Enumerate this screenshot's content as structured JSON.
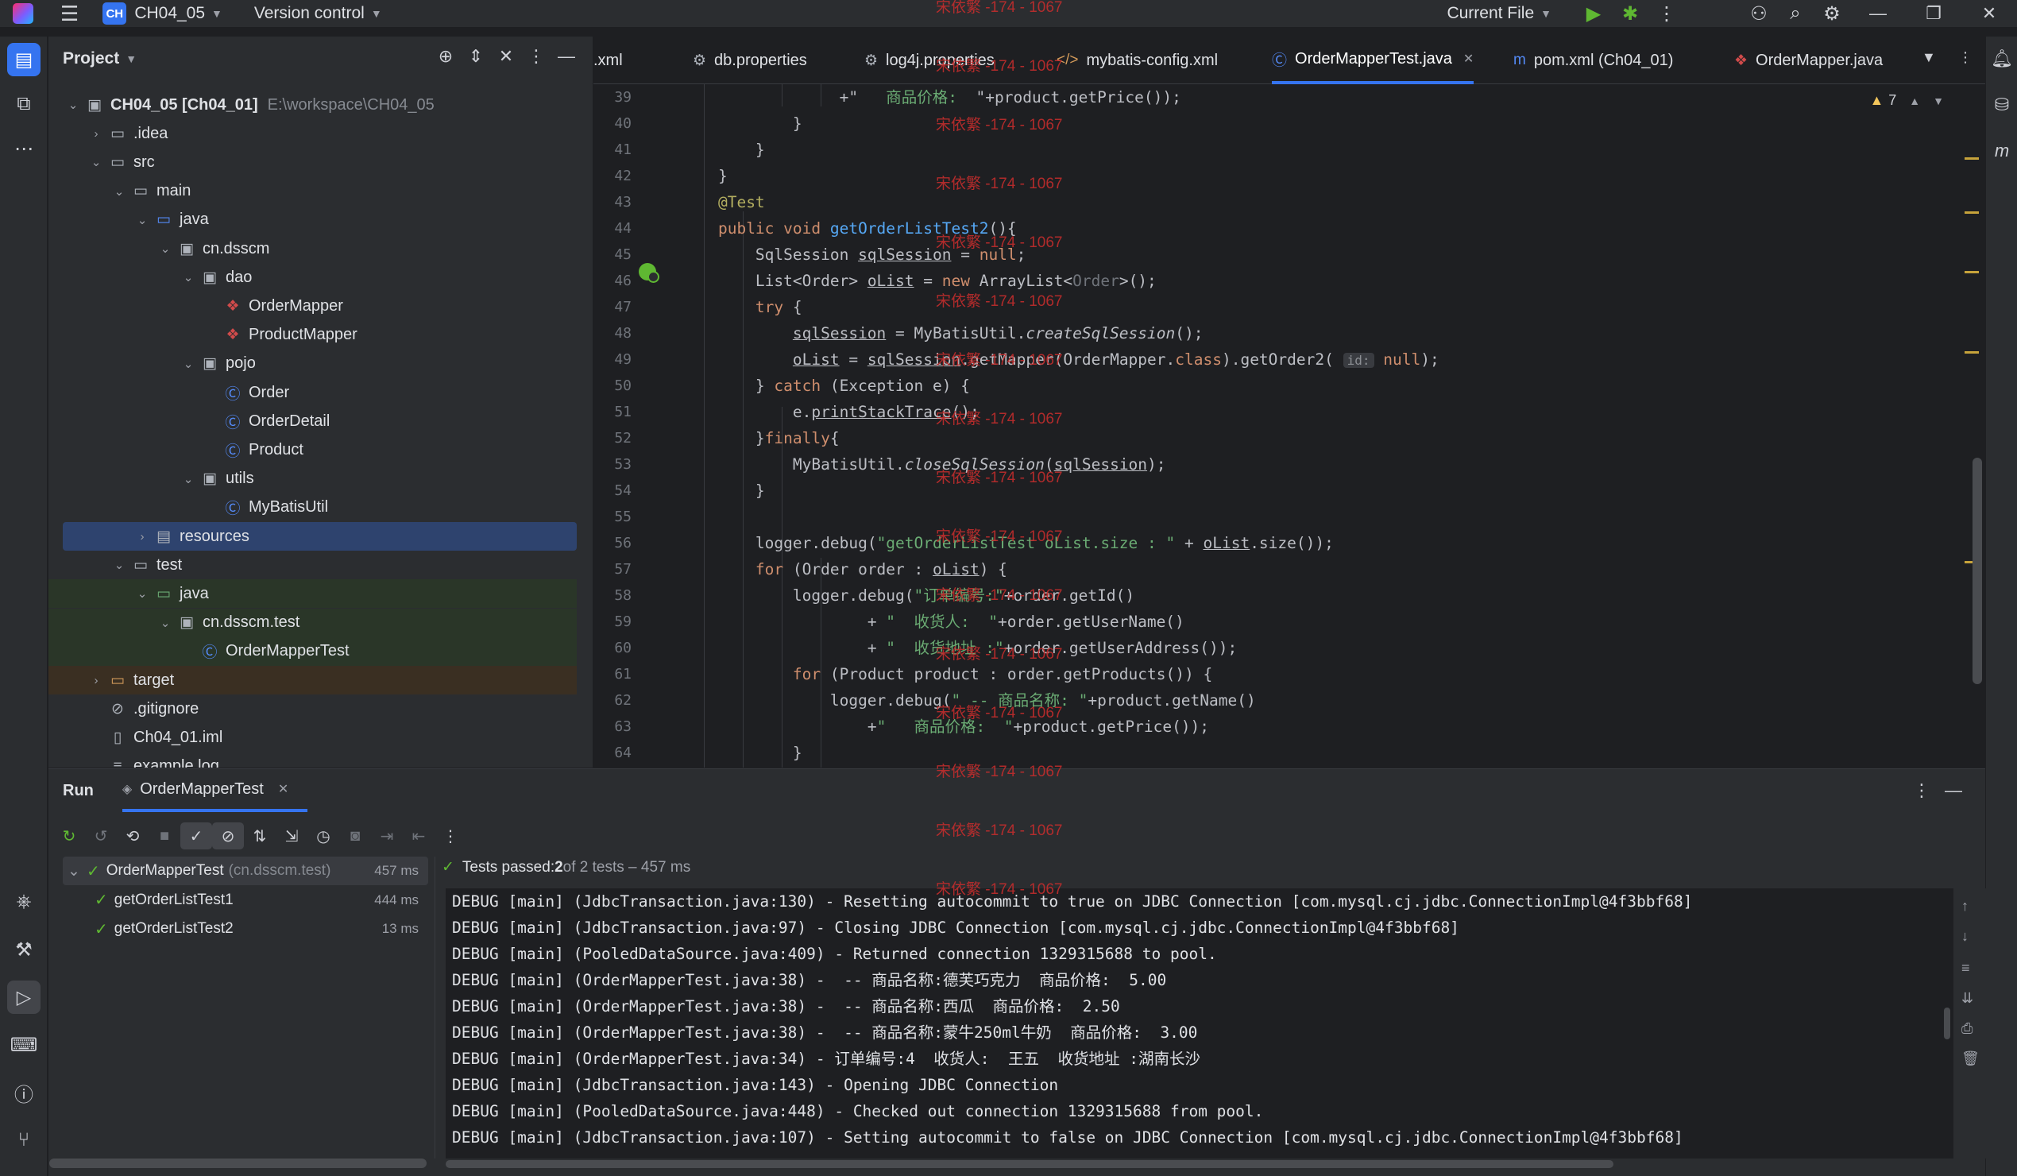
{
  "titlebar": {
    "project_badge": "CH",
    "project_name": "CH04_05",
    "version_control": "Version control",
    "run_config": "Current File"
  },
  "project_panel": {
    "title": "Project",
    "tree": [
      {
        "label": "CH04_05 [Ch04_01]",
        "sub": "E:\\workspace\\CH04_05",
        "depth": 0,
        "arrow": "down",
        "icon": "module-icon"
      },
      {
        "label": ".idea",
        "depth": 1,
        "arrow": "right",
        "icon": "folder-icon"
      },
      {
        "label": "src",
        "depth": 1,
        "arrow": "down",
        "icon": "folder-icon"
      },
      {
        "label": "main",
        "depth": 2,
        "arrow": "down",
        "icon": "folder-icon"
      },
      {
        "label": "java",
        "depth": 3,
        "arrow": "down",
        "icon": "source-folder-icon"
      },
      {
        "label": "cn.dsscm",
        "depth": 4,
        "arrow": "down",
        "icon": "package-icon"
      },
      {
        "label": "dao",
        "depth": 5,
        "arrow": "down",
        "icon": "package-icon"
      },
      {
        "label": "OrderMapper",
        "depth": 6,
        "arrow": "",
        "icon": "mybatis-mapper-icon"
      },
      {
        "label": "ProductMapper",
        "depth": 6,
        "arrow": "",
        "icon": "mybatis-mapper-icon"
      },
      {
        "label": "pojo",
        "depth": 5,
        "arrow": "down",
        "icon": "package-icon"
      },
      {
        "label": "Order",
        "depth": 6,
        "arrow": "",
        "icon": "class-icon"
      },
      {
        "label": "OrderDetail",
        "depth": 6,
        "arrow": "",
        "icon": "class-icon"
      },
      {
        "label": "Product",
        "depth": 6,
        "arrow": "",
        "icon": "class-icon"
      },
      {
        "label": "utils",
        "depth": 5,
        "arrow": "down",
        "icon": "package-icon"
      },
      {
        "label": "MyBatisUtil",
        "depth": 6,
        "arrow": "",
        "icon": "class-icon"
      },
      {
        "label": "resources",
        "depth": 3,
        "arrow": "right",
        "icon": "resources-folder-icon",
        "selected": true
      },
      {
        "label": "test",
        "depth": 2,
        "arrow": "down",
        "icon": "folder-icon"
      },
      {
        "label": "java",
        "depth": 3,
        "arrow": "down",
        "icon": "test-folder-icon",
        "test": true
      },
      {
        "label": "cn.dsscm.test",
        "depth": 4,
        "arrow": "down",
        "icon": "package-icon",
        "test": true
      },
      {
        "label": "OrderMapperTest",
        "depth": 5,
        "arrow": "",
        "icon": "class-icon",
        "test": true
      },
      {
        "label": "target",
        "depth": 1,
        "arrow": "right",
        "icon": "excluded-folder-icon",
        "target": true
      },
      {
        "label": ".gitignore",
        "depth": 1,
        "arrow": "",
        "icon": "ignore-file-icon"
      },
      {
        "label": "Ch04_01.iml",
        "depth": 1,
        "arrow": "",
        "icon": "iml-file-icon"
      },
      {
        "label": "example.log",
        "depth": 1,
        "arrow": "",
        "icon": "text-file-icon"
      }
    ]
  },
  "editor": {
    "tabs": [
      {
        "label": ".xml",
        "icon": ""
      },
      {
        "label": "db.properties",
        "icon": "gear-icon"
      },
      {
        "label": "log4j.properties",
        "icon": "gear-icon"
      },
      {
        "label": "mybatis-config.xml",
        "icon": "xml-icon"
      },
      {
        "label": "OrderMapperTest.java",
        "icon": "class-icon",
        "active": true
      },
      {
        "label": "pom.xml (Ch04_01)",
        "icon": "maven-icon"
      },
      {
        "label": "OrderMapper.java",
        "icon": "mybatis-mapper-icon"
      }
    ],
    "warnings_count": "7",
    "inlay_hint": "id:",
    "line_numbers": [
      "39",
      "40",
      "41",
      "42",
      "43",
      "44",
      "45",
      "46",
      "47",
      "48",
      "49",
      "50",
      "51",
      "52",
      "53",
      "54",
      "55",
      "56",
      "57",
      "58",
      "59",
      "60",
      "61",
      "62",
      "63",
      "64"
    ],
    "code": {
      "l39a": "+\"   ",
      "l39b": "商品价格:",
      "l39c": "  \"+product.getPrice());",
      "l40": "}",
      "l41": "}",
      "l42": "}",
      "l43": "@Test",
      "l44_kw": "public void ",
      "l44_fn": "getOrderListTest2",
      "l44_rest": "(){",
      "l45a": "SqlSession ",
      "l45b": "sqlSession",
      "l45c": " = ",
      "l45d": "null",
      "l45e": ";",
      "l46a": "List<Order> ",
      "l46b": "oList",
      "l46c": " = ",
      "l46d": "new",
      "l46e": " ArrayList<",
      "l46f": "Order",
      "l46g": ">();",
      "l47": "try",
      "l47b": " {",
      "l48a": "sqlSession",
      "l48b": " = MyBatisUtil.",
      "l48c": "createSqlSession",
      "l48d": "();",
      "l49a": "oList",
      "l49b": " = ",
      "l49c": "sqlSession",
      "l49d": ".getMapper(OrderMapper.",
      "l49e": "class",
      "l49f": ").getOrder2(",
      "l49g": "null",
      "l49h": ");",
      "l50a": "} ",
      "l50b": "catch",
      "l50c": " (Exception e) {",
      "l51a": "e.",
      "l51b": "printStackTrace",
      "l51c": "();",
      "l52a": "}",
      "l52b": "finally",
      "l52c": "{",
      "l53a": "MyBatisUtil.",
      "l53b": "closeSqlSession",
      "l53c": "(",
      "l53d": "sqlSession",
      "l53e": ");",
      "l54": "}",
      "l56a": "logger",
      "l56b": ".debug(",
      "l56c": "\"getOrderListTest oList.size : \"",
      "l56d": " + ",
      "l56e": "oList",
      "l56f": ".size());",
      "l57a": "for",
      "l57b": " (Order order : ",
      "l57c": "oList",
      "l57d": ") {",
      "l58a": "logger",
      "l58b": ".debug(",
      "l58c": "\"订单编号:\"",
      "l58d": "+order.getId()",
      "l59a": "+ ",
      "l59b": "\"  收货人:  \"",
      "l59c": "+order.getUserName()",
      "l60a": "+ ",
      "l60b": "\"  收货地址 :\"",
      "l60c": "+order.getUserAddress());",
      "l61a": "for",
      "l61b": " (Product product : order.getProducts()) {",
      "l62a": "logger",
      "l62b": ".debug(",
      "l62c": "\" -- 商品名称: \"",
      "l62d": "+product.getName()",
      "l63a": "+",
      "l63b": "\"   商品价格:  \"",
      "l63c": "+product.getPrice());",
      "l64": "}"
    }
  },
  "watermark": "宋依繁 -174 - 1067",
  "run_panel": {
    "title": "Run",
    "tab": "OrderMapperTest",
    "status_prefix": "Tests passed: ",
    "status_bold": "2",
    "status_suffix": " of 2 tests – 457 ms",
    "tests": [
      {
        "name": "OrderMapperTest",
        "pkg": "(cn.dsscm.test)",
        "time": "457 ms"
      },
      {
        "name": "getOrderListTest1",
        "time": "444 ms"
      },
      {
        "name": "getOrderListTest2",
        "time": "13 ms"
      }
    ],
    "console": [
      "DEBUG [main] (JdbcTransaction.java:130) - Resetting autocommit to true on JDBC Connection [com.mysql.cj.jdbc.ConnectionImpl@4f3bbf68]",
      "DEBUG [main] (JdbcTransaction.java:97) - Closing JDBC Connection [com.mysql.cj.jdbc.ConnectionImpl@4f3bbf68]",
      "DEBUG [main] (PooledDataSource.java:409) - Returned connection 1329315688 to pool.",
      "DEBUG [main] (OrderMapperTest.java:38) -  -- 商品名称:德芙巧克力  商品价格:  5.00",
      "DEBUG [main] (OrderMapperTest.java:38) -  -- 商品名称:西瓜  商品价格:  2.50",
      "DEBUG [main] (OrderMapperTest.java:38) -  -- 商品名称:蒙牛250ml牛奶  商品价格:  3.00",
      "DEBUG [main] (OrderMapperTest.java:34) - 订单编号:4  收货人:  王五  收货地址 :湖南长沙",
      "DEBUG [main] (JdbcTransaction.java:143) - Opening JDBC Connection",
      "DEBUG [main] (PooledDataSource.java:448) - Checked out connection 1329315688 from pool.",
      "DEBUG [main] (JdbcTransaction.java:107) - Setting autocommit to false on JDBC Connection [com.mysql.cj.jdbc.ConnectionImpl@4f3bbf68]"
    ]
  },
  "colors": {
    "accent": "#3574f0",
    "success": "#5fb832",
    "watermark": "#c22d2d"
  }
}
